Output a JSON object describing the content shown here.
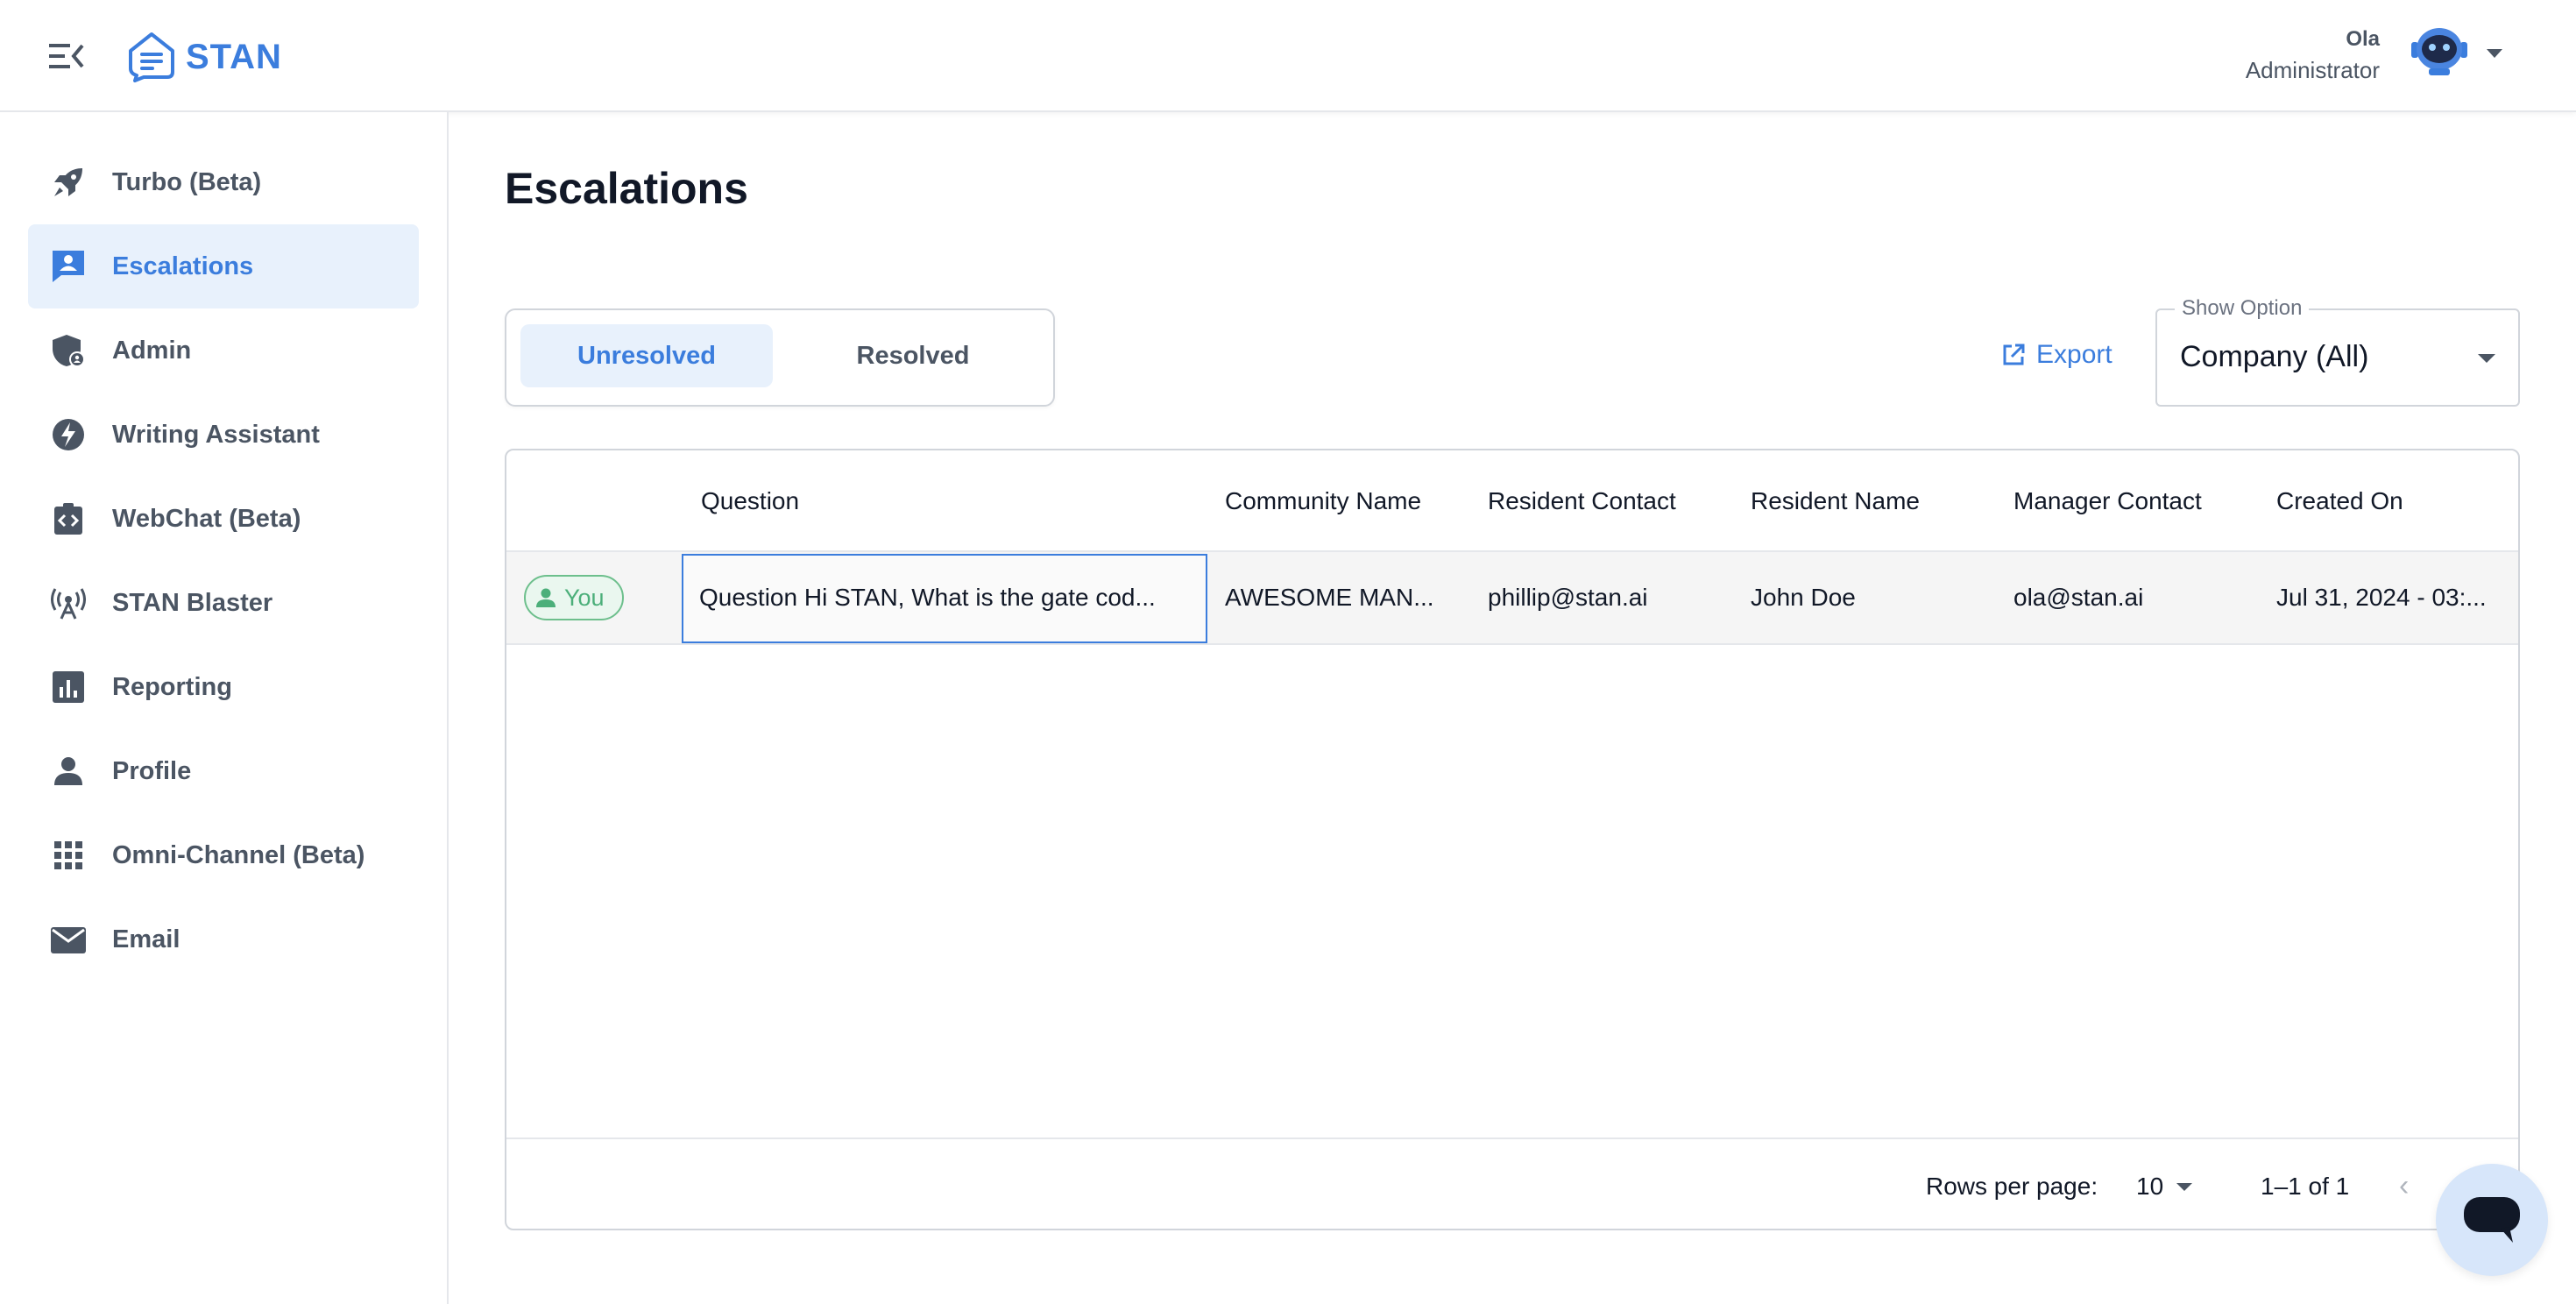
{
  "app": {
    "brand": "STAN",
    "accent_color": "#3b7ddd"
  },
  "header": {
    "user_name": "Ola",
    "user_role": "Administrator"
  },
  "sidebar": {
    "items": [
      {
        "label": "Turbo (Beta)",
        "icon": "rocket-icon"
      },
      {
        "label": "Escalations",
        "icon": "escalation-icon",
        "active": true
      },
      {
        "label": "Admin",
        "icon": "admin-shield-icon"
      },
      {
        "label": "Writing Assistant",
        "icon": "lightning-icon"
      },
      {
        "label": "WebChat (Beta)",
        "icon": "code-clipboard-icon"
      },
      {
        "label": "STAN Blaster",
        "icon": "broadcast-icon"
      },
      {
        "label": "Reporting",
        "icon": "chart-icon"
      },
      {
        "label": "Profile",
        "icon": "person-icon"
      },
      {
        "label": "Omni-Channel (Beta)",
        "icon": "grid-icon"
      },
      {
        "label": "Email",
        "icon": "mail-icon"
      }
    ]
  },
  "main": {
    "title": "Escalations",
    "tabs": [
      {
        "label": "Unresolved",
        "active": true
      },
      {
        "label": "Resolved",
        "active": false
      }
    ],
    "export_label": "Export",
    "show_option": {
      "legend": "Show Option",
      "value": "Company (All)"
    }
  },
  "table": {
    "columns": [
      "Question",
      "Community Name",
      "Resident Contact",
      "Resident Name",
      "Manager Contact",
      "Created On"
    ],
    "rows": [
      {
        "assignee_chip": "You",
        "question": "Question Hi STAN, What is the gate cod...",
        "community_name": "AWESOME MAN...",
        "resident_contact": "phillip@stan.ai",
        "resident_name": "John Doe",
        "manager_contact": "ola@stan.ai",
        "created_on": "Jul 31, 2024 - 03:..."
      }
    ],
    "footer": {
      "rows_per_page_label": "Rows per page:",
      "rows_per_page_value": "10",
      "range": "1–1 of 1"
    }
  }
}
